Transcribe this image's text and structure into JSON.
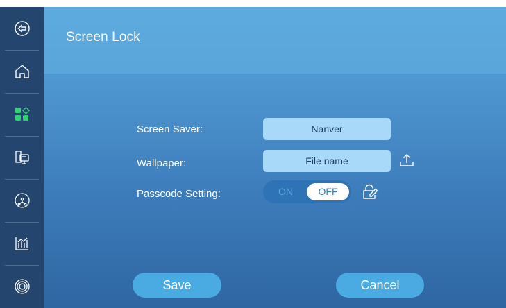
{
  "page": {
    "title": "Screen Lock"
  },
  "sidebar": {
    "items": [
      {
        "id": "back",
        "icon": "back-arrow-icon"
      },
      {
        "id": "home",
        "icon": "home-icon"
      },
      {
        "id": "apps",
        "icon": "apps-grid-icon"
      },
      {
        "id": "devices",
        "icon": "devices-icon"
      },
      {
        "id": "network",
        "icon": "network-icon"
      },
      {
        "id": "statistics",
        "icon": "bar-chart-icon"
      },
      {
        "id": "settings",
        "icon": "target-icon"
      }
    ]
  },
  "form": {
    "screen_saver": {
      "label": "Screen Saver:",
      "value": "Nanver"
    },
    "wallpaper": {
      "label": "Wallpaper:",
      "value": "File name",
      "upload_icon": "upload-icon"
    },
    "passcode": {
      "label": "Passcode Setting:",
      "on_label": "ON",
      "off_label": "OFF",
      "selected": "OFF",
      "edit_icon": "lock-edit-icon"
    }
  },
  "actions": {
    "save_label": "Save",
    "cancel_label": "Cancel"
  },
  "colors": {
    "sidebar": "#24466e",
    "header": "#5aa7dc",
    "panel_bottom": "#2e66a2",
    "field": "#a9d9f8",
    "button": "#4aaae2",
    "toggle_track": "#2e73b5"
  }
}
